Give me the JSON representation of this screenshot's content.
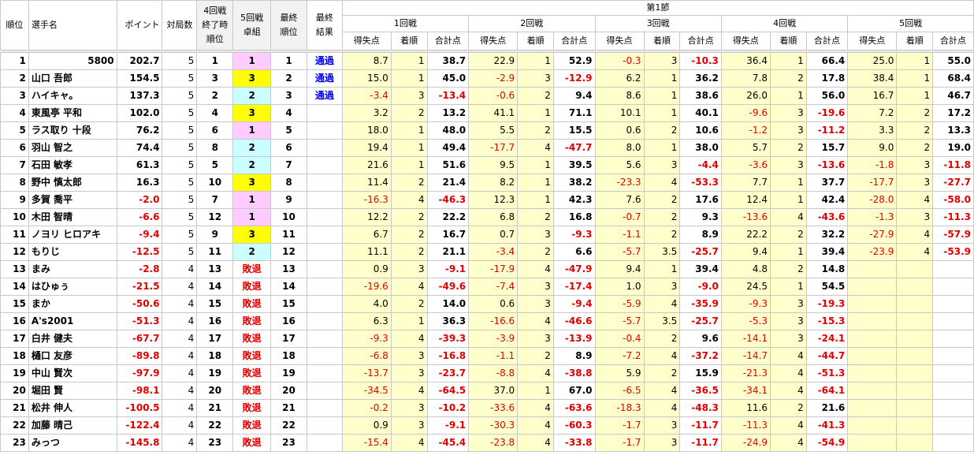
{
  "header": {
    "rank": "順位",
    "player": "選手名",
    "points": "ポイント",
    "games": "対局数",
    "r4_rank": "4回戦\n終了時\n順位",
    "r5_table": "5回戦\n卓組",
    "final_rank": "最終\n順位",
    "final_result": "最終\n結果",
    "section": "第1節",
    "rounds": [
      "1回戦",
      "2回戦",
      "3回戦",
      "4回戦",
      "5回戦"
    ],
    "sub": [
      "得失点",
      "着順",
      "合計点"
    ]
  },
  "rows": [
    {
      "rank": "1",
      "name": "5800",
      "pts": "202.7",
      "games": "5",
      "r4": "1",
      "grp": "1",
      "final": "1",
      "result": "通過",
      "r": [
        [
          "8.7",
          "1",
          "38.7"
        ],
        [
          "22.9",
          "1",
          "52.9"
        ],
        [
          "-0.3",
          "3",
          "-10.3"
        ],
        [
          "36.4",
          "1",
          "66.4"
        ],
        [
          "25.0",
          "1",
          "55.0"
        ]
      ]
    },
    {
      "rank": "2",
      "name": "山口 吾郎",
      "pts": "154.5",
      "games": "5",
      "r4": "3",
      "grp": "3",
      "final": "2",
      "result": "通過",
      "r": [
        [
          "15.0",
          "1",
          "45.0"
        ],
        [
          "-2.9",
          "3",
          "-12.9"
        ],
        [
          "6.2",
          "1",
          "36.2"
        ],
        [
          "7.8",
          "2",
          "17.8"
        ],
        [
          "38.4",
          "1",
          "68.4"
        ]
      ]
    },
    {
      "rank": "3",
      "name": "ハイキャ。",
      "pts": "137.3",
      "games": "5",
      "r4": "2",
      "grp": "2",
      "final": "3",
      "result": "通過",
      "r": [
        [
          "-3.4",
          "3",
          "-13.4"
        ],
        [
          "-0.6",
          "2",
          "9.4"
        ],
        [
          "8.6",
          "1",
          "38.6"
        ],
        [
          "26.0",
          "1",
          "56.0"
        ],
        [
          "16.7",
          "1",
          "46.7"
        ]
      ]
    },
    {
      "rank": "4",
      "name": "東風亭 平和",
      "pts": "102.0",
      "games": "5",
      "r4": "4",
      "grp": "3",
      "final": "4",
      "result": "",
      "r": [
        [
          "3.2",
          "2",
          "13.2"
        ],
        [
          "41.1",
          "1",
          "71.1"
        ],
        [
          "10.1",
          "1",
          "40.1"
        ],
        [
          "-9.6",
          "3",
          "-19.6"
        ],
        [
          "7.2",
          "2",
          "17.2"
        ]
      ]
    },
    {
      "rank": "5",
      "name": "ラス取り 十段",
      "pts": "76.2",
      "games": "5",
      "r4": "6",
      "grp": "1",
      "final": "5",
      "result": "",
      "r": [
        [
          "18.0",
          "1",
          "48.0"
        ],
        [
          "5.5",
          "2",
          "15.5"
        ],
        [
          "0.6",
          "2",
          "10.6"
        ],
        [
          "-1.2",
          "3",
          "-11.2"
        ],
        [
          "3.3",
          "2",
          "13.3"
        ]
      ]
    },
    {
      "rank": "6",
      "name": "羽山 智之",
      "pts": "74.4",
      "games": "5",
      "r4": "8",
      "grp": "2",
      "final": "6",
      "result": "",
      "r": [
        [
          "19.4",
          "1",
          "49.4"
        ],
        [
          "-17.7",
          "4",
          "-47.7"
        ],
        [
          "8.0",
          "1",
          "38.0"
        ],
        [
          "5.7",
          "2",
          "15.7"
        ],
        [
          "9.0",
          "2",
          "19.0"
        ]
      ]
    },
    {
      "rank": "7",
      "name": "石田 敏孝",
      "pts": "61.3",
      "games": "5",
      "r4": "5",
      "grp": "2",
      "final": "7",
      "result": "",
      "r": [
        [
          "21.6",
          "1",
          "51.6"
        ],
        [
          "9.5",
          "1",
          "39.5"
        ],
        [
          "5.6",
          "3",
          "-4.4"
        ],
        [
          "-3.6",
          "3",
          "-13.6"
        ],
        [
          "-1.8",
          "3",
          "-11.8"
        ]
      ]
    },
    {
      "rank": "8",
      "name": "野中 慎太郎",
      "pts": "16.3",
      "games": "5",
      "r4": "10",
      "grp": "3",
      "final": "8",
      "result": "",
      "r": [
        [
          "11.4",
          "2",
          "21.4"
        ],
        [
          "8.2",
          "1",
          "38.2"
        ],
        [
          "-23.3",
          "4",
          "-53.3"
        ],
        [
          "7.7",
          "1",
          "37.7"
        ],
        [
          "-17.7",
          "3",
          "-27.7"
        ]
      ]
    },
    {
      "rank": "9",
      "name": "多賀 喬平",
      "pts": "-2.0",
      "games": "5",
      "r4": "7",
      "grp": "1",
      "final": "9",
      "result": "",
      "r": [
        [
          "-16.3",
          "4",
          "-46.3"
        ],
        [
          "12.3",
          "1",
          "42.3"
        ],
        [
          "7.6",
          "2",
          "17.6"
        ],
        [
          "12.4",
          "1",
          "42.4"
        ],
        [
          "-28.0",
          "4",
          "-58.0"
        ]
      ]
    },
    {
      "rank": "10",
      "name": "木田 智晴",
      "pts": "-6.6",
      "games": "5",
      "r4": "12",
      "grp": "1",
      "final": "10",
      "result": "",
      "r": [
        [
          "12.2",
          "2",
          "22.2"
        ],
        [
          "6.8",
          "2",
          "16.8"
        ],
        [
          "-0.7",
          "2",
          "9.3"
        ],
        [
          "-13.6",
          "4",
          "-43.6"
        ],
        [
          "-1.3",
          "3",
          "-11.3"
        ]
      ]
    },
    {
      "rank": "11",
      "name": "ノヨリ ヒロアキ",
      "pts": "-9.4",
      "games": "5",
      "r4": "9",
      "grp": "3",
      "final": "11",
      "result": "",
      "r": [
        [
          "6.7",
          "2",
          "16.7"
        ],
        [
          "0.7",
          "3",
          "-9.3"
        ],
        [
          "-1.1",
          "2",
          "8.9"
        ],
        [
          "22.2",
          "2",
          "32.2"
        ],
        [
          "-27.9",
          "4",
          "-57.9"
        ]
      ]
    },
    {
      "rank": "12",
      "name": "もりじ",
      "pts": "-12.5",
      "games": "5",
      "r4": "11",
      "grp": "2",
      "final": "12",
      "result": "",
      "r": [
        [
          "11.1",
          "2",
          "21.1"
        ],
        [
          "-3.4",
          "2",
          "6.6"
        ],
        [
          "-5.7",
          "3.5",
          "-25.7"
        ],
        [
          "9.4",
          "1",
          "39.4"
        ],
        [
          "-23.9",
          "4",
          "-53.9"
        ]
      ]
    },
    {
      "rank": "13",
      "name": "まみ",
      "pts": "-2.8",
      "games": "4",
      "r4": "13",
      "grp": "敗退",
      "final": "13",
      "result": "",
      "r": [
        [
          "0.9",
          "3",
          "-9.1"
        ],
        [
          "-17.9",
          "4",
          "-47.9"
        ],
        [
          "9.4",
          "1",
          "39.4"
        ],
        [
          "4.8",
          "2",
          "14.8"
        ],
        [
          "",
          "",
          ""
        ]
      ]
    },
    {
      "rank": "14",
      "name": "はひゅぅ",
      "pts": "-21.5",
      "games": "4",
      "r4": "14",
      "grp": "敗退",
      "final": "14",
      "result": "",
      "r": [
        [
          "-19.6",
          "4",
          "-49.6"
        ],
        [
          "-7.4",
          "3",
          "-17.4"
        ],
        [
          "1.0",
          "3",
          "-9.0"
        ],
        [
          "24.5",
          "1",
          "54.5"
        ],
        [
          "",
          "",
          ""
        ]
      ]
    },
    {
      "rank": "15",
      "name": "まか",
      "pts": "-50.6",
      "games": "4",
      "r4": "15",
      "grp": "敗退",
      "final": "15",
      "result": "",
      "r": [
        [
          "4.0",
          "2",
          "14.0"
        ],
        [
          "0.6",
          "3",
          "-9.4"
        ],
        [
          "-5.9",
          "4",
          "-35.9"
        ],
        [
          "-9.3",
          "3",
          "-19.3"
        ],
        [
          "",
          "",
          ""
        ]
      ]
    },
    {
      "rank": "16",
      "name": "A's2001",
      "pts": "-51.3",
      "games": "4",
      "r4": "16",
      "grp": "敗退",
      "final": "16",
      "result": "",
      "r": [
        [
          "6.3",
          "1",
          "36.3"
        ],
        [
          "-16.6",
          "4",
          "-46.6"
        ],
        [
          "-5.7",
          "3.5",
          "-25.7"
        ],
        [
          "-5.3",
          "3",
          "-15.3"
        ],
        [
          "",
          "",
          ""
        ]
      ]
    },
    {
      "rank": "17",
      "name": "白井 健夫",
      "pts": "-67.7",
      "games": "4",
      "r4": "17",
      "grp": "敗退",
      "final": "17",
      "result": "",
      "r": [
        [
          "-9.3",
          "4",
          "-39.3"
        ],
        [
          "-3.9",
          "3",
          "-13.9"
        ],
        [
          "-0.4",
          "2",
          "9.6"
        ],
        [
          "-14.1",
          "3",
          "-24.1"
        ],
        [
          "",
          "",
          ""
        ]
      ]
    },
    {
      "rank": "18",
      "name": "樋口 友彦",
      "pts": "-89.8",
      "games": "4",
      "r4": "18",
      "grp": "敗退",
      "final": "18",
      "result": "",
      "r": [
        [
          "-6.8",
          "3",
          "-16.8"
        ],
        [
          "-1.1",
          "2",
          "8.9"
        ],
        [
          "-7.2",
          "4",
          "-37.2"
        ],
        [
          "-14.7",
          "4",
          "-44.7"
        ],
        [
          "",
          "",
          ""
        ]
      ]
    },
    {
      "rank": "19",
      "name": "中山 賢次",
      "pts": "-97.9",
      "games": "4",
      "r4": "19",
      "grp": "敗退",
      "final": "19",
      "result": "",
      "r": [
        [
          "-13.7",
          "3",
          "-23.7"
        ],
        [
          "-8.8",
          "4",
          "-38.8"
        ],
        [
          "5.9",
          "2",
          "15.9"
        ],
        [
          "-21.3",
          "4",
          "-51.3"
        ],
        [
          "",
          "",
          ""
        ]
      ]
    },
    {
      "rank": "20",
      "name": "堀田 賢",
      "pts": "-98.1",
      "games": "4",
      "r4": "20",
      "grp": "敗退",
      "final": "20",
      "result": "",
      "r": [
        [
          "-34.5",
          "4",
          "-64.5"
        ],
        [
          "37.0",
          "1",
          "67.0"
        ],
        [
          "-6.5",
          "4",
          "-36.5"
        ],
        [
          "-34.1",
          "4",
          "-64.1"
        ],
        [
          "",
          "",
          ""
        ]
      ]
    },
    {
      "rank": "21",
      "name": "松井 伸人",
      "pts": "-100.5",
      "games": "4",
      "r4": "21",
      "grp": "敗退",
      "final": "21",
      "result": "",
      "r": [
        [
          "-0.2",
          "3",
          "-10.2"
        ],
        [
          "-33.6",
          "4",
          "-63.6"
        ],
        [
          "-18.3",
          "4",
          "-48.3"
        ],
        [
          "11.6",
          "2",
          "21.6"
        ],
        [
          "",
          "",
          ""
        ]
      ]
    },
    {
      "rank": "22",
      "name": "加藤 晴己",
      "pts": "-122.4",
      "games": "4",
      "r4": "22",
      "grp": "敗退",
      "final": "22",
      "result": "",
      "r": [
        [
          "0.9",
          "3",
          "-9.1"
        ],
        [
          "-30.3",
          "4",
          "-60.3"
        ],
        [
          "-1.7",
          "3",
          "-11.7"
        ],
        [
          "-11.3",
          "4",
          "-41.3"
        ],
        [
          "",
          "",
          ""
        ]
      ]
    },
    {
      "rank": "23",
      "name": "みっつ",
      "pts": "-145.8",
      "games": "4",
      "r4": "23",
      "grp": "敗退",
      "final": "23",
      "result": "",
      "r": [
        [
          "-15.4",
          "4",
          "-45.4"
        ],
        [
          "-23.8",
          "4",
          "-33.8"
        ],
        [
          "-1.7",
          "3",
          "-11.7"
        ],
        [
          "-24.9",
          "4",
          "-54.9"
        ],
        [
          "",
          "",
          ""
        ]
      ]
    }
  ]
}
